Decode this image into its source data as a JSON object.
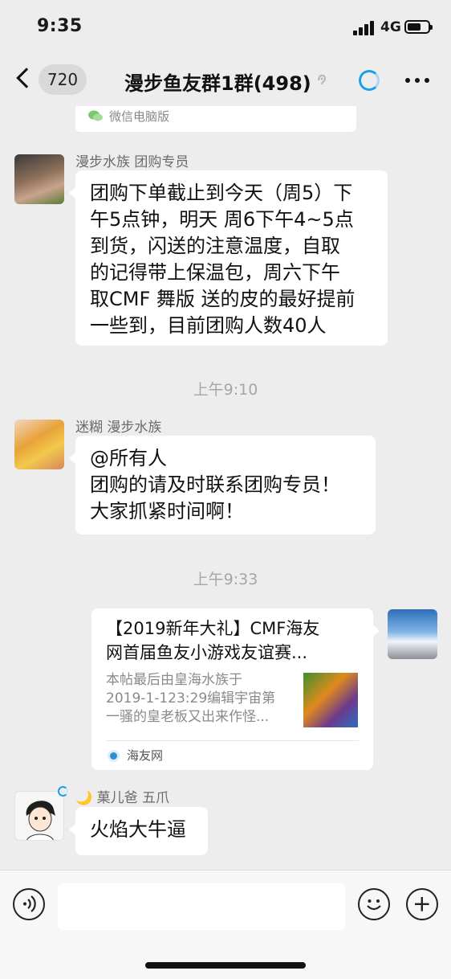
{
  "status": {
    "time": "9:35",
    "network": "4G"
  },
  "nav": {
    "unread_count": "720",
    "title": "漫步鱼友群1群(498)"
  },
  "top_card": {
    "source": "微信电脑版"
  },
  "messages": [
    {
      "sender": "漫步水族 团购专员",
      "lines": [
        "团购下单截止到今天（周5）下",
        "午5点钟，明天 周6下午4~5点",
        "到货，闪送的注意温度，自取",
        "的记得带上保温包，周六下午",
        "取CMF 舞版 送的皮的最好提前",
        "一些到，目前团购人数40人"
      ]
    },
    {
      "sender": "迷糊 漫步水族",
      "lines": [
        "@所有人",
        "团购的请及时联系团购专员！",
        "大家抓紧时间啊！"
      ]
    },
    {
      "sender": "🌙 菓儿爸 五爪",
      "lines": [
        "火焰大牛逼"
      ]
    }
  ],
  "time_separators": [
    "上午9:10",
    "上午9:33"
  ],
  "link_card": {
    "title_lines": [
      "【2019新年大礼】CMF海友",
      "网首届鱼友小游戏友谊赛..."
    ],
    "desc_lines": [
      "本帖最后由皇海水族于",
      "2019-1-123:29编辑宇宙第",
      "一骚的皇老板又出来作怪..."
    ],
    "source": "海友网"
  },
  "input": {
    "placeholder": ""
  },
  "colors": {
    "background": "#ededed",
    "bubble": "#ffffff",
    "accent": "#1aa1e6"
  }
}
